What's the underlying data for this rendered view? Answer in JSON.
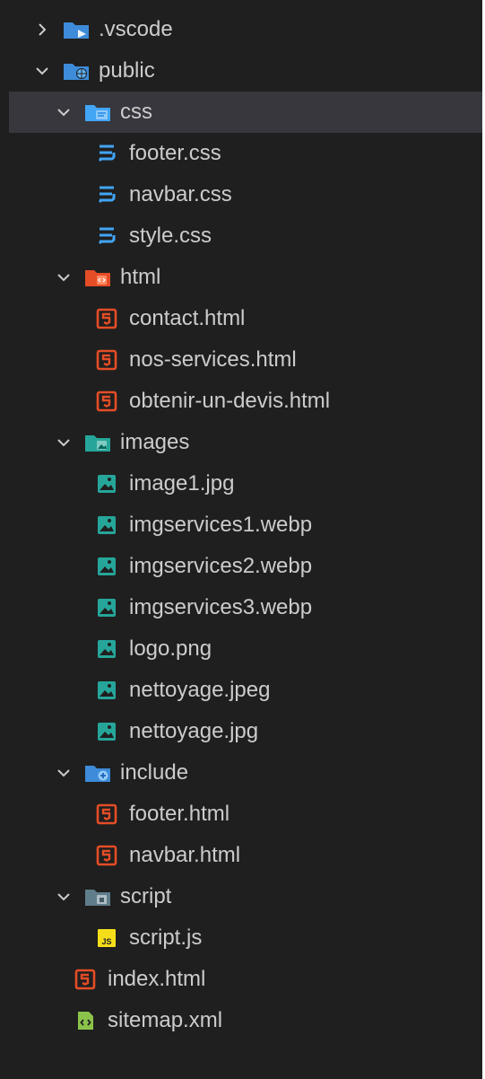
{
  "explorer": {
    "items": [
      {
        "label": ".vscode",
        "kind": "folder",
        "icon": "vscode-folder-icon",
        "expanded": false,
        "level": 0
      },
      {
        "label": "public",
        "kind": "folder",
        "icon": "public-folder-icon",
        "expanded": true,
        "level": 0
      },
      {
        "label": "css",
        "kind": "folder",
        "icon": "css-folder-icon",
        "expanded": true,
        "level": 1,
        "selected": true
      },
      {
        "label": "footer.css",
        "kind": "file",
        "icon": "css-file-icon",
        "level": 2
      },
      {
        "label": "navbar.css",
        "kind": "file",
        "icon": "css-file-icon",
        "level": 2
      },
      {
        "label": "style.css",
        "kind": "file",
        "icon": "css-file-icon",
        "level": 2
      },
      {
        "label": "html",
        "kind": "folder",
        "icon": "html-folder-icon",
        "expanded": true,
        "level": 1
      },
      {
        "label": "contact.html",
        "kind": "file",
        "icon": "html-file-icon",
        "level": 2
      },
      {
        "label": "nos-services.html",
        "kind": "file",
        "icon": "html-file-icon",
        "level": 2
      },
      {
        "label": "obtenir-un-devis.html",
        "kind": "file",
        "icon": "html-file-icon",
        "level": 2
      },
      {
        "label": "images",
        "kind": "folder",
        "icon": "images-folder-icon",
        "expanded": true,
        "level": 1
      },
      {
        "label": "image1.jpg",
        "kind": "file",
        "icon": "image-file-icon",
        "level": 2
      },
      {
        "label": "imgservices1.webp",
        "kind": "file",
        "icon": "image-file-icon",
        "level": 2
      },
      {
        "label": "imgservices2.webp",
        "kind": "file",
        "icon": "image-file-icon",
        "level": 2
      },
      {
        "label": "imgservices3.webp",
        "kind": "file",
        "icon": "image-file-icon",
        "level": 2
      },
      {
        "label": "logo.png",
        "kind": "file",
        "icon": "image-file-icon",
        "level": 2
      },
      {
        "label": "nettoyage.jpeg",
        "kind": "file",
        "icon": "image-file-icon",
        "level": 2
      },
      {
        "label": "nettoyage.jpg",
        "kind": "file",
        "icon": "image-file-icon",
        "level": 2
      },
      {
        "label": "include",
        "kind": "folder",
        "icon": "include-folder-icon",
        "expanded": true,
        "level": 1
      },
      {
        "label": "footer.html",
        "kind": "file",
        "icon": "html-file-icon",
        "level": 2
      },
      {
        "label": "navbar.html",
        "kind": "file",
        "icon": "html-file-icon",
        "level": 2
      },
      {
        "label": "script",
        "kind": "folder",
        "icon": "script-folder-icon",
        "expanded": true,
        "level": 1
      },
      {
        "label": "script.js",
        "kind": "file",
        "icon": "js-file-icon",
        "level": 2
      },
      {
        "label": "index.html",
        "kind": "file",
        "icon": "html-file-icon",
        "level": 1
      },
      {
        "label": "sitemap.xml",
        "kind": "file",
        "icon": "xml-file-icon",
        "level": 1
      }
    ]
  },
  "colors": {
    "background": "#1f1f1f",
    "selected_row": "#37373d",
    "text": "#cccccc",
    "css_blue": "#42a5f5",
    "html_orange": "#e44d26",
    "image_teal": "#26a69a",
    "js_yellow": "#f5de19",
    "xml_green": "#8bc34a"
  }
}
